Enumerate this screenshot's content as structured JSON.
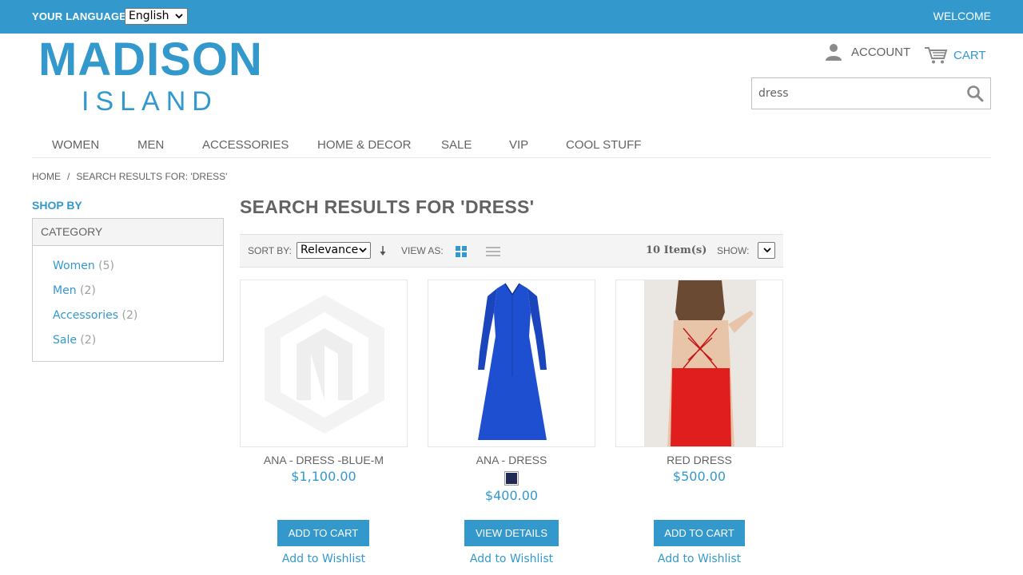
{
  "topbar": {
    "language_label": "YOUR LANGUAGE:",
    "language_value": "English",
    "welcome": "WELCOME"
  },
  "logo": {
    "main": "MADISON",
    "sub": "ISLAND"
  },
  "header": {
    "account": "ACCOUNT",
    "cart": "CART"
  },
  "search": {
    "value": "dress"
  },
  "nav": {
    "items": [
      {
        "label": "WOMEN"
      },
      {
        "label": "MEN"
      },
      {
        "label": "ACCESSORIES"
      },
      {
        "label": "HOME & DECOR"
      },
      {
        "label": "SALE"
      },
      {
        "label": "VIP"
      },
      {
        "label": "COOL STUFF"
      }
    ]
  },
  "breadcrumb": {
    "home": "HOME",
    "separator": "/",
    "current": "SEARCH RESULTS FOR: 'DRESS'"
  },
  "sidebar": {
    "shop_by": "SHOP BY",
    "category_title": "CATEGORY",
    "categories": [
      {
        "name": "Women",
        "count": "(5)"
      },
      {
        "name": "Men",
        "count": "(2)"
      },
      {
        "name": "Accessories",
        "count": "(2)"
      },
      {
        "name": "Sale",
        "count": "(2)"
      }
    ]
  },
  "main": {
    "title": "SEARCH RESULTS FOR 'DRESS'"
  },
  "toolbar": {
    "sort_by_label": "SORT BY:",
    "sort_value": "Relevance",
    "view_as_label": "VIEW AS:",
    "items_count": "10 Item(s)",
    "show_label": "SHOW:",
    "show_value": ""
  },
  "products": [
    {
      "name": "ANA - DRESS -BLUE-M",
      "price": "$1,100.00",
      "button": "ADD TO CART",
      "wishlist": "Add to Wishlist"
    },
    {
      "name": "ANA - DRESS",
      "price": "$400.00",
      "button": "VIEW DETAILS",
      "wishlist": "Add to Wishlist",
      "swatch_color": "#1f2a55"
    },
    {
      "name": "RED DRESS",
      "price": "$500.00",
      "button": "ADD TO CART",
      "wishlist": "Add to Wishlist"
    }
  ],
  "colors": {
    "accent": "#3399cc",
    "text": "#636363",
    "dress_blue": "#1e4fd0",
    "dress_red": "#e01e1e"
  }
}
